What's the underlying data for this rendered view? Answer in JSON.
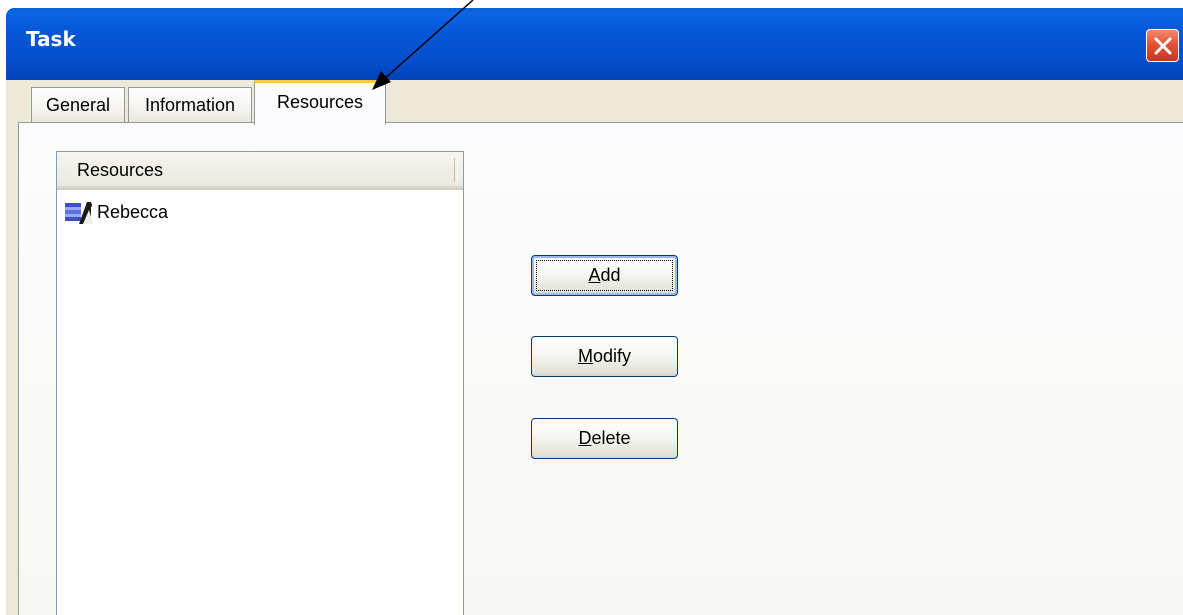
{
  "window": {
    "title": "Task"
  },
  "tabs": [
    {
      "label": "General",
      "active": false
    },
    {
      "label": "Information",
      "active": false
    },
    {
      "label": "Resources",
      "active": true
    }
  ],
  "resources_list": {
    "column_header": "Resources",
    "items": [
      {
        "label": "Rebecca",
        "icon": "resource-person-icon"
      }
    ]
  },
  "buttons": {
    "add": {
      "accel": "A",
      "rest": "dd"
    },
    "modify": {
      "accel": "M",
      "rest": "odify"
    },
    "delete": {
      "accel": "D",
      "rest": "elete"
    }
  },
  "colors": {
    "titlebar": "#0558d8",
    "active_tab_accent": "#ffc83c",
    "dialog_face": "#ece9d8"
  }
}
